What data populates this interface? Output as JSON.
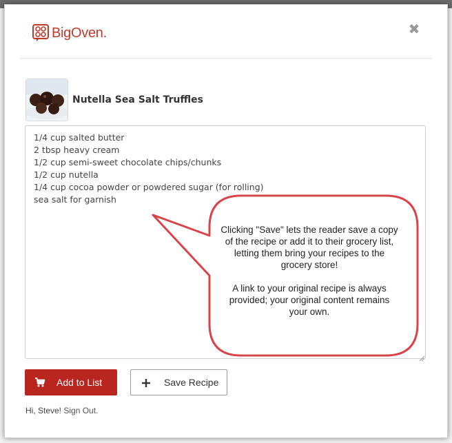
{
  "brand": {
    "name": "BigOven.",
    "color": "#c0392b"
  },
  "modal": {
    "close_icon": "close-icon"
  },
  "recipe": {
    "title": "Nutella Sea Salt Truffles",
    "ingredients": "1/4 cup salted butter\n2 tbsp heavy cream\n1/2 cup semi-sweet chocolate chips/chunks\n1/2 cup nutella\n1/4 cup cocoa powder or powdered sugar (for rolling)\nsea salt for garnish"
  },
  "actions": {
    "add_to_list": "Add to List",
    "save_recipe": "Save Recipe",
    "add_color": "#b8261f"
  },
  "user": {
    "greeting": "Hi, Steve!",
    "sign_out": "Sign Out."
  },
  "callout": {
    "paragraph1": "Clicking \"Save\" lets the reader save a copy of the recipe or add it to their grocery list, letting them bring your recipes to the grocery store!",
    "paragraph2": "A link to your original recipe is always provided; your original content remains your own.",
    "border_color": "#d9444a"
  }
}
